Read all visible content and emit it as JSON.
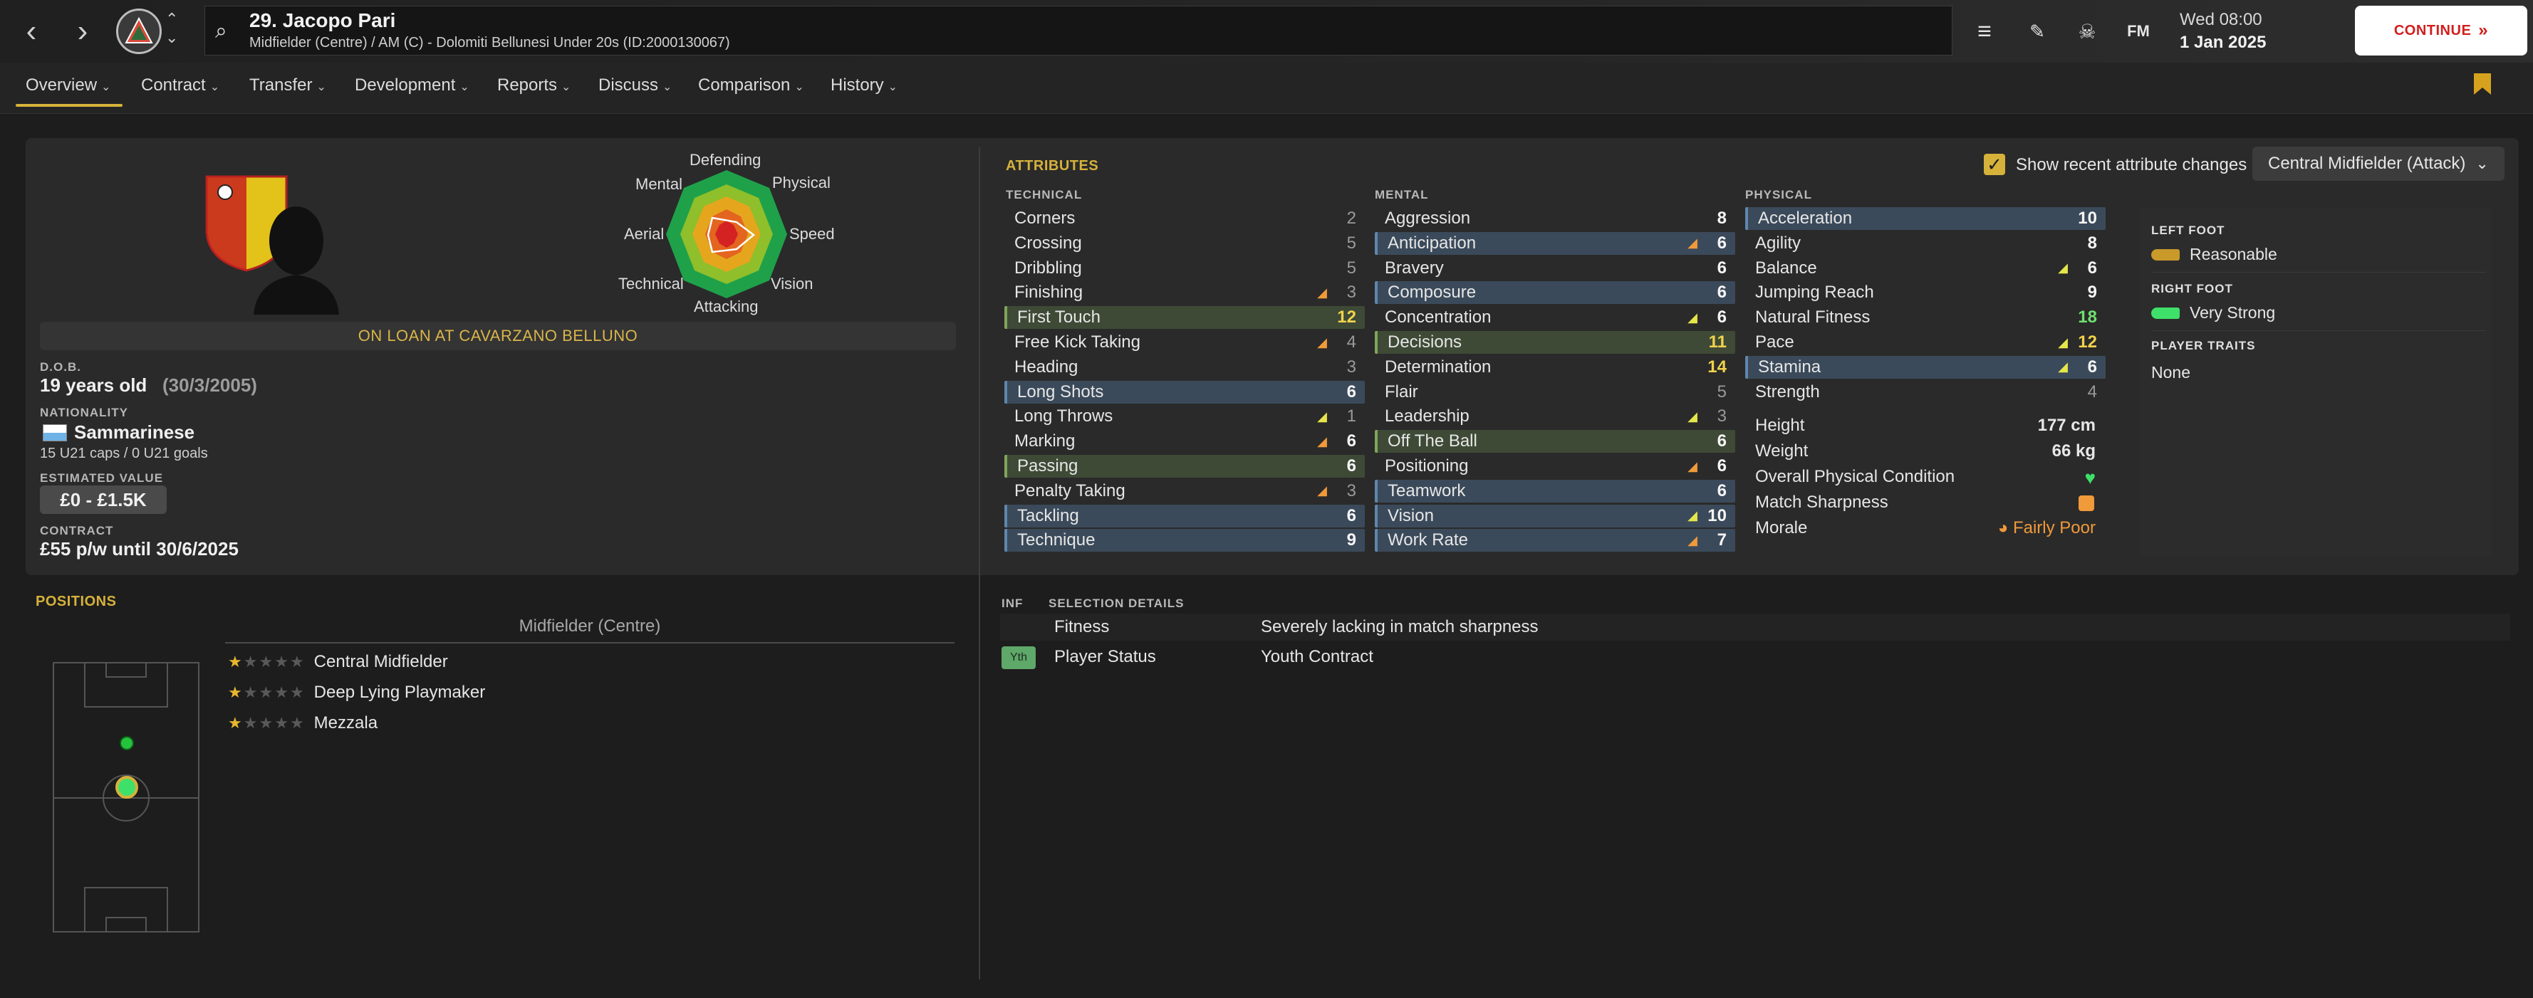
{
  "header": {
    "player_title": "29. Jacopo Pari",
    "player_subtitle": "Midfielder (Centre) / AM (C) - Dolomiti Bellunesi Under 20s (ID:2000130067)",
    "time": "Wed 08:00",
    "date": "1 Jan 2025",
    "continue_label": "CONTINUE",
    "fm_label": "FM",
    "icons": [
      "back-arrow-icon",
      "forward-arrow-icon",
      "club-crest-icon",
      "menu-icon",
      "edit-icon",
      "skull-icon",
      "fm-logo-icon",
      "bookmark-icon"
    ]
  },
  "tabs": [
    {
      "label": "Overview"
    },
    {
      "label": "Contract"
    },
    {
      "label": "Transfer"
    },
    {
      "label": "Development"
    },
    {
      "label": "Reports"
    },
    {
      "label": "Discuss"
    },
    {
      "label": "Comparison"
    },
    {
      "label": "History"
    }
  ],
  "profile": {
    "badge_text": "A.S.D. CAVARZANO BELLUNO 1965",
    "on_loan": "ON LOAN AT CAVARZANO BELLUNO",
    "dob_label": "D.O.B.",
    "age": "19 years old",
    "dob": "(30/3/2005)",
    "nationality_label": "NATIONALITY",
    "nationality": "Sammarinese",
    "caps": "15 U21 caps / 0 U21 goals",
    "value_label": "ESTIMATED VALUE",
    "value": "£0 - £1.5K",
    "contract_label": "CONTRACT",
    "contract": "£55 p/w until 30/6/2025"
  },
  "radar": {
    "labels": {
      "top": "Defending",
      "top_right": "Physical",
      "right": "Speed",
      "bottom_right": "Vision",
      "bottom": "Attacking",
      "bottom_left": "Technical",
      "left": "Aerial",
      "top_left": "Mental"
    }
  },
  "attributes": {
    "heading": "ATTRIBUTES",
    "show_recent_label": "Show recent attribute changes",
    "role": "Central Midfielder (Attack)",
    "technical_head": "TECHNICAL",
    "mental_head": "MENTAL",
    "physical_head": "PHYSICAL",
    "technical": [
      {
        "name": "Corners",
        "value": "2",
        "arrow": "",
        "hl": "",
        "col": "dim"
      },
      {
        "name": "Crossing",
        "value": "5",
        "arrow": "",
        "hl": "",
        "col": "dim"
      },
      {
        "name": "Dribbling",
        "value": "5",
        "arrow": "",
        "hl": "",
        "col": "dim"
      },
      {
        "name": "Finishing",
        "value": "3",
        "arrow": "up-o",
        "hl": "",
        "col": "dim"
      },
      {
        "name": "First Touch",
        "value": "12",
        "arrow": "",
        "hl": "green",
        "col": "yellow"
      },
      {
        "name": "Free Kick Taking",
        "value": "4",
        "arrow": "up-o",
        "hl": "",
        "col": "dim"
      },
      {
        "name": "Heading",
        "value": "3",
        "arrow": "",
        "hl": "",
        "col": "dim"
      },
      {
        "name": "Long Shots",
        "value": "6",
        "arrow": "",
        "hl": "blue",
        "col": "white"
      },
      {
        "name": "Long Throws",
        "value": "1",
        "arrow": "up-y",
        "hl": "",
        "col": "dim"
      },
      {
        "name": "Marking",
        "value": "6",
        "arrow": "up-o",
        "hl": "",
        "col": "white"
      },
      {
        "name": "Passing",
        "value": "6",
        "arrow": "",
        "hl": "green",
        "col": "white"
      },
      {
        "name": "Penalty Taking",
        "value": "3",
        "arrow": "up-o",
        "hl": "",
        "col": "dim"
      },
      {
        "name": "Tackling",
        "value": "6",
        "arrow": "",
        "hl": "blue",
        "col": "white"
      },
      {
        "name": "Technique",
        "value": "9",
        "arrow": "",
        "hl": "blue",
        "col": "white"
      }
    ],
    "mental": [
      {
        "name": "Aggression",
        "value": "8",
        "arrow": "",
        "hl": "",
        "col": "white"
      },
      {
        "name": "Anticipation",
        "value": "6",
        "arrow": "up-o",
        "hl": "blue",
        "col": "white"
      },
      {
        "name": "Bravery",
        "value": "6",
        "arrow": "",
        "hl": "",
        "col": "white"
      },
      {
        "name": "Composure",
        "value": "6",
        "arrow": "",
        "hl": "blue",
        "col": "white"
      },
      {
        "name": "Concentration",
        "value": "6",
        "arrow": "up-y",
        "hl": "",
        "col": "white"
      },
      {
        "name": "Decisions",
        "value": "11",
        "arrow": "",
        "hl": "green",
        "col": "yellow"
      },
      {
        "name": "Determination",
        "value": "14",
        "arrow": "",
        "hl": "",
        "col": "yellow"
      },
      {
        "name": "Flair",
        "value": "5",
        "arrow": "",
        "hl": "",
        "col": "dim"
      },
      {
        "name": "Leadership",
        "value": "3",
        "arrow": "up-y",
        "hl": "",
        "col": "dim"
      },
      {
        "name": "Off The Ball",
        "value": "6",
        "arrow": "",
        "hl": "green",
        "col": "white"
      },
      {
        "name": "Positioning",
        "value": "6",
        "arrow": "up-o",
        "hl": "",
        "col": "white"
      },
      {
        "name": "Teamwork",
        "value": "6",
        "arrow": "",
        "hl": "blue",
        "col": "white"
      },
      {
        "name": "Vision",
        "value": "10",
        "arrow": "up-y",
        "hl": "blue",
        "col": "white"
      },
      {
        "name": "Work Rate",
        "value": "7",
        "arrow": "up-o",
        "hl": "blue",
        "col": "white"
      }
    ],
    "physical": [
      {
        "name": "Acceleration",
        "value": "10",
        "arrow": "",
        "hl": "blue",
        "col": "white"
      },
      {
        "name": "Agility",
        "value": "8",
        "arrow": "",
        "hl": "",
        "col": "white"
      },
      {
        "name": "Balance",
        "value": "6",
        "arrow": "up-y",
        "hl": "",
        "col": "white"
      },
      {
        "name": "Jumping Reach",
        "value": "9",
        "arrow": "",
        "hl": "",
        "col": "white"
      },
      {
        "name": "Natural Fitness",
        "value": "18",
        "arrow": "",
        "hl": "",
        "col": "green"
      },
      {
        "name": "Pace",
        "value": "12",
        "arrow": "up-y",
        "hl": "",
        "col": "yellow"
      },
      {
        "name": "Stamina",
        "value": "6",
        "arrow": "up-y",
        "hl": "blue",
        "col": "white"
      },
      {
        "name": "Strength",
        "value": "4",
        "arrow": "",
        "hl": "",
        "col": "dim"
      }
    ]
  },
  "physical_info": {
    "height_label": "Height",
    "height": "177 cm",
    "weight_label": "Weight",
    "weight": "66 kg",
    "condition_label": "Overall Physical Condition",
    "sharpness_label": "Match Sharpness",
    "morale_label": "Morale",
    "morale": "Fairly Poor"
  },
  "feet": {
    "left_label": "LEFT FOOT",
    "left": "Reasonable",
    "right_label": "RIGHT FOOT",
    "right": "Very Strong",
    "traits_label": "PLAYER TRAITS",
    "traits": "None"
  },
  "positions": {
    "heading": "POSITIONS",
    "main_position": "Midfielder (Centre)",
    "roles": [
      {
        "name": "Central Midfielder",
        "stars": 1
      },
      {
        "name": "Deep Lying Playmaker",
        "stars": 1
      },
      {
        "name": "Mezzala",
        "stars": 1
      }
    ]
  },
  "selection": {
    "inf_head": "INF",
    "details_head": "SELECTION DETAILS",
    "rows": [
      {
        "badge": "",
        "label": "Fitness",
        "value": "Severely lacking in match sharpness"
      },
      {
        "badge": "Yth",
        "label": "Player Status",
        "value": "Youth Contract"
      }
    ]
  },
  "colors": {
    "accent": "#d6b23a",
    "continue_text": "#d11e1e",
    "blue_row": "#3b4a5a",
    "green_row": "#3e4a36",
    "morale": "#f09a3a"
  }
}
